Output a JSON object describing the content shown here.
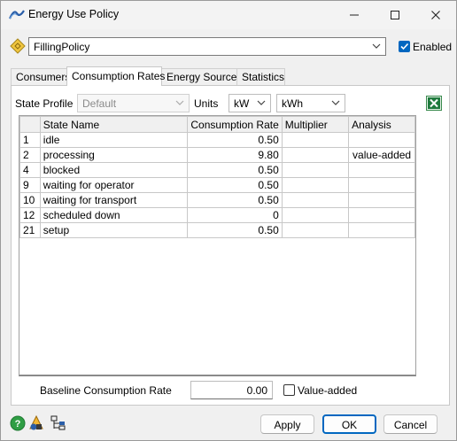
{
  "window": {
    "title": "Energy Use Policy",
    "icons": {
      "app": "energy-curve-icon",
      "minimize": "minimize-icon",
      "maximize": "maximize-icon",
      "close": "close-icon"
    }
  },
  "policy": {
    "selected": "FillingPolicy",
    "enabled_label": "Enabled",
    "enabled_checked": true,
    "icon": "policy-diamond-icon"
  },
  "tabs": [
    {
      "label": "Consumers",
      "active": false
    },
    {
      "label": "Consumption Rates",
      "active": true
    },
    {
      "label": "Energy Sources",
      "active": false
    },
    {
      "label": "Statistics",
      "active": false
    }
  ],
  "filters": {
    "state_profile_label": "State Profile",
    "state_profile_value": "Default",
    "units_label": "Units",
    "power_unit": "kW",
    "energy_unit": "kWh",
    "export_icon": "excel-export-icon"
  },
  "table": {
    "columns": [
      "State Name",
      "Consumption Rate",
      "Multiplier",
      "Analysis"
    ],
    "rows": [
      {
        "id": "1",
        "state": "idle",
        "rate": "0.50",
        "multiplier": "",
        "analysis": ""
      },
      {
        "id": "2",
        "state": "processing",
        "rate": "9.80",
        "multiplier": "",
        "analysis": "value-added"
      },
      {
        "id": "4",
        "state": "blocked",
        "rate": "0.50",
        "multiplier": "",
        "analysis": ""
      },
      {
        "id": "9",
        "state": "waiting for operator",
        "rate": "0.50",
        "multiplier": "",
        "analysis": ""
      },
      {
        "id": "10",
        "state": "waiting for transport",
        "rate": "0.50",
        "multiplier": "",
        "analysis": ""
      },
      {
        "id": "12",
        "state": "scheduled down",
        "rate": "0",
        "multiplier": "",
        "analysis": ""
      },
      {
        "id": "21",
        "state": "setup",
        "rate": "0.50",
        "multiplier": "",
        "analysis": ""
      }
    ]
  },
  "baseline": {
    "label": "Baseline Consumption Rate",
    "value": "0.00",
    "value_added_label": "Value-added",
    "value_added_checked": false
  },
  "footer": {
    "help_icon": "help-icon",
    "tool_icon_1": "flexsim-tool-icon",
    "tool_icon_2": "tree-view-icon",
    "apply_label": "Apply",
    "ok_label": "OK",
    "cancel_label": "Cancel"
  }
}
